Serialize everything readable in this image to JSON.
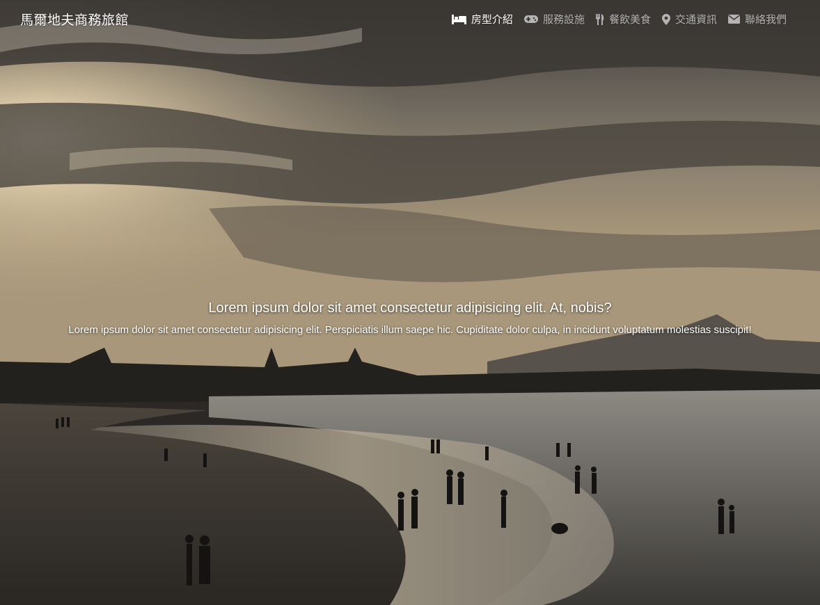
{
  "brand": "馬爾地夫商務旅館",
  "nav": {
    "items": [
      {
        "label": "房型介紹",
        "icon": "bed-icon",
        "active": true
      },
      {
        "label": "服務設施",
        "icon": "gamepad-icon",
        "active": false
      },
      {
        "label": "餐飲美食",
        "icon": "utensils-icon",
        "active": false
      },
      {
        "label": "交通資訊",
        "icon": "map-marker-icon",
        "active": false
      },
      {
        "label": "聯絡我們",
        "icon": "envelope-icon",
        "active": false
      }
    ]
  },
  "hero": {
    "title": "Lorem ipsum dolor sit amet consectetur adipisicing elit. At, nobis?",
    "text": "Lorem ipsum dolor sit amet consectetur adipisicing elit. Perspiciatis illum saepe hic. Cupiditate dolor culpa, in incidunt voluptatum molestias suscipit!",
    "image": "beach-sunset-photo"
  },
  "colors": {
    "nav_active": "#ffffff",
    "nav_inactive": "#b4b4b4",
    "text": "#ffffff"
  }
}
